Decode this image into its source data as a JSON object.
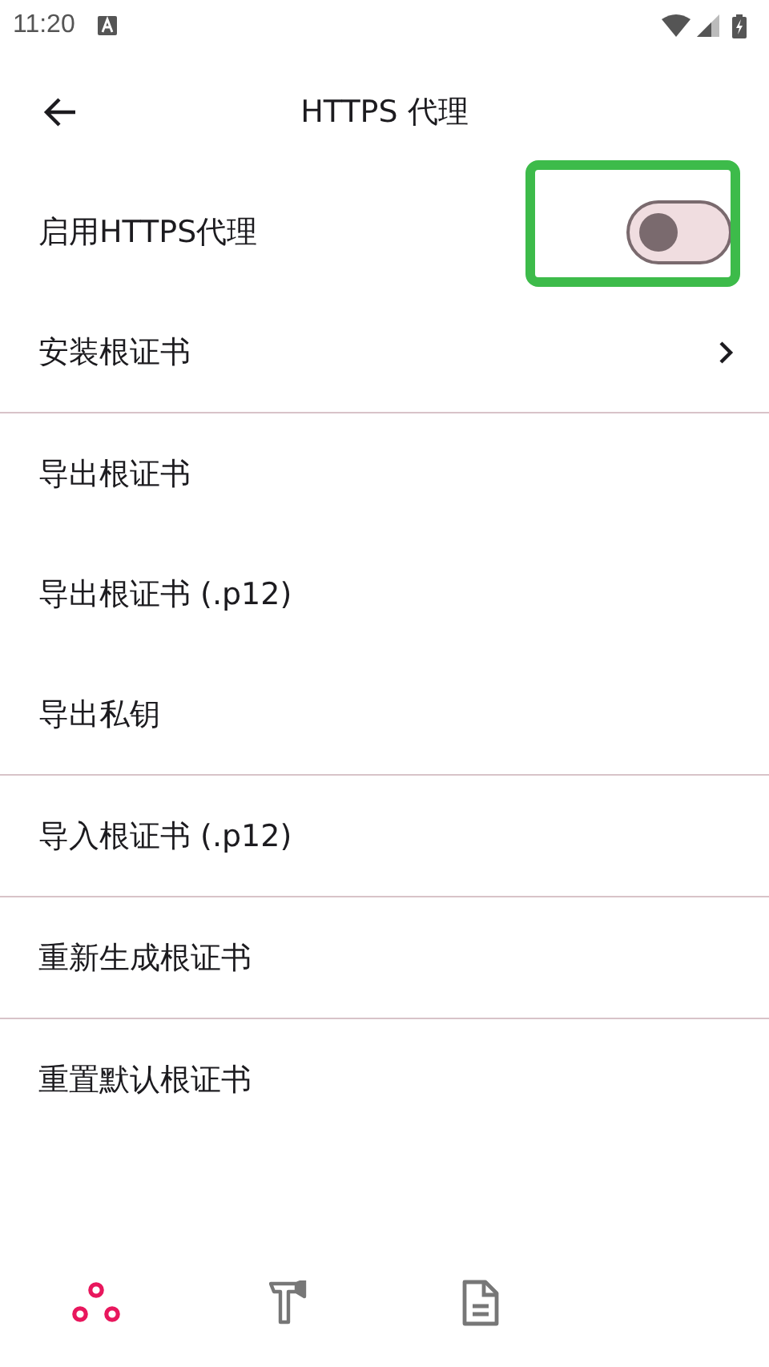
{
  "status_bar": {
    "time": "11:20"
  },
  "header": {
    "title": "HTTPS 代理"
  },
  "settings": [
    {
      "kind": "switch",
      "label": "启用HTTPS代理",
      "on": false,
      "highlighted": true,
      "divider_after": false
    },
    {
      "kind": "link",
      "label": "安装根证书",
      "divider_after": true
    },
    {
      "kind": "plain",
      "label": "导出根证书",
      "divider_after": false
    },
    {
      "kind": "plain",
      "label": "导出根证书 (.p12)",
      "divider_after": false
    },
    {
      "kind": "plain",
      "label": "导出私钥",
      "divider_after": true
    },
    {
      "kind": "plain",
      "label": "导入根证书 (.p12)",
      "divider_after": true
    },
    {
      "kind": "plain",
      "label": "重新生成根证书",
      "divider_after": true
    },
    {
      "kind": "plain",
      "label": "重置默认根证书",
      "divider_after": false
    }
  ],
  "bottom_nav": [
    {
      "kind": "network",
      "selected": true
    },
    {
      "kind": "tools",
      "selected": false
    },
    {
      "kind": "logs",
      "selected": false
    }
  ]
}
